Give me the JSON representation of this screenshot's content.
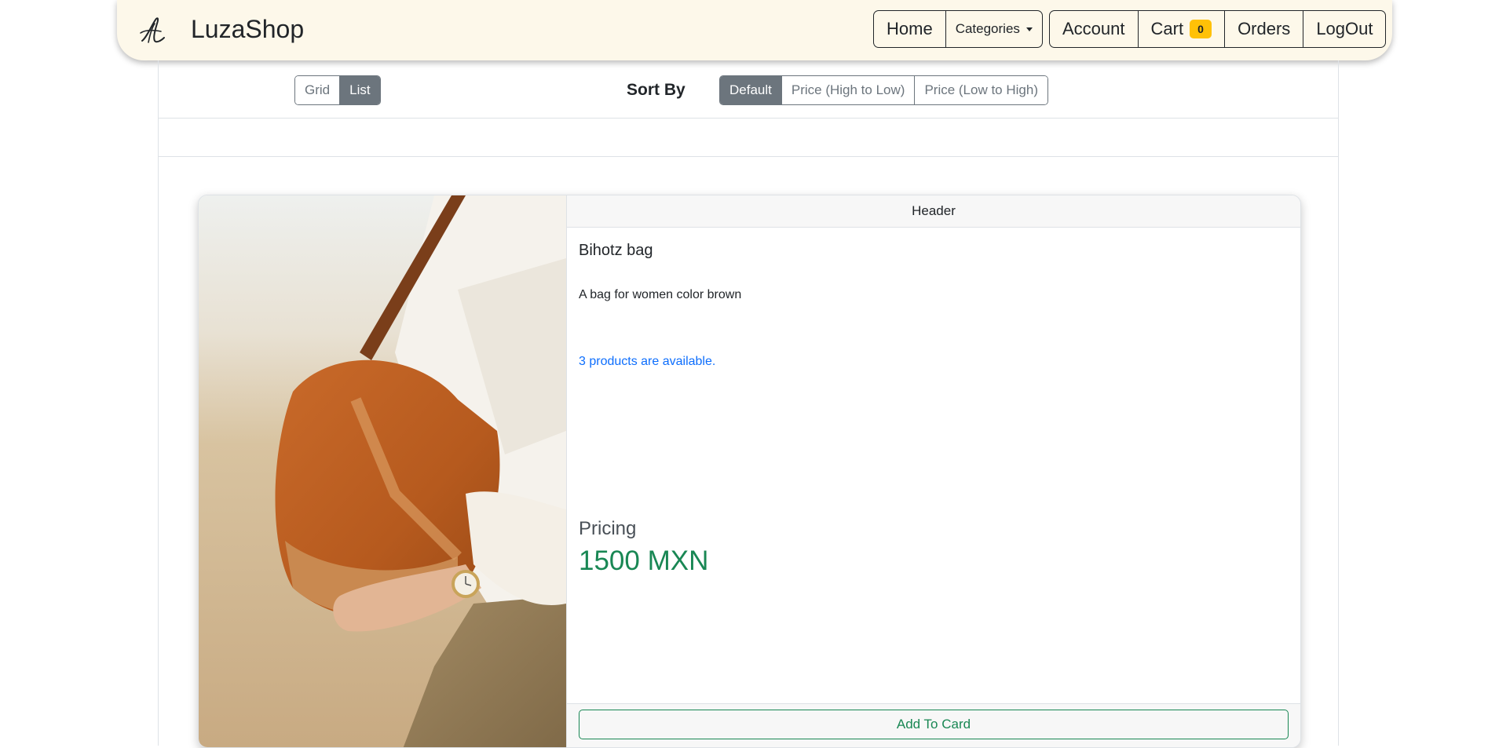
{
  "navbar": {
    "brand": "LuzaShop",
    "logo_icon": "signature-logo-icon",
    "nav_left": {
      "home": "Home",
      "categories": "Categories"
    },
    "nav_right": {
      "account": "Account",
      "cart": "Cart",
      "cart_count": "0",
      "orders": "Orders",
      "logout": "LogOut"
    }
  },
  "toolbar": {
    "view_options": [
      "Grid",
      "List"
    ],
    "view_selected": "List",
    "sort_label": "Sort By",
    "sort_options": [
      "Default",
      "Price (High to Low)",
      "Price (Low to High)"
    ],
    "sort_selected": "Default"
  },
  "product": {
    "header": "Header",
    "title": "Bihotz bag",
    "description": "A bag for women color brown",
    "availability": "3 products are available.",
    "pricing_label": "Pricing",
    "price": "1500 MXN",
    "add_button": "Add To Card",
    "image_alt": "woman-holding-brown-suede-bag-photo"
  },
  "colors": {
    "navbar_bg": "#fdf8ea",
    "accent_green": "#198754",
    "link_blue": "#0d6efd",
    "badge_yellow": "#ffc107",
    "segment_active": "#6c757d"
  }
}
